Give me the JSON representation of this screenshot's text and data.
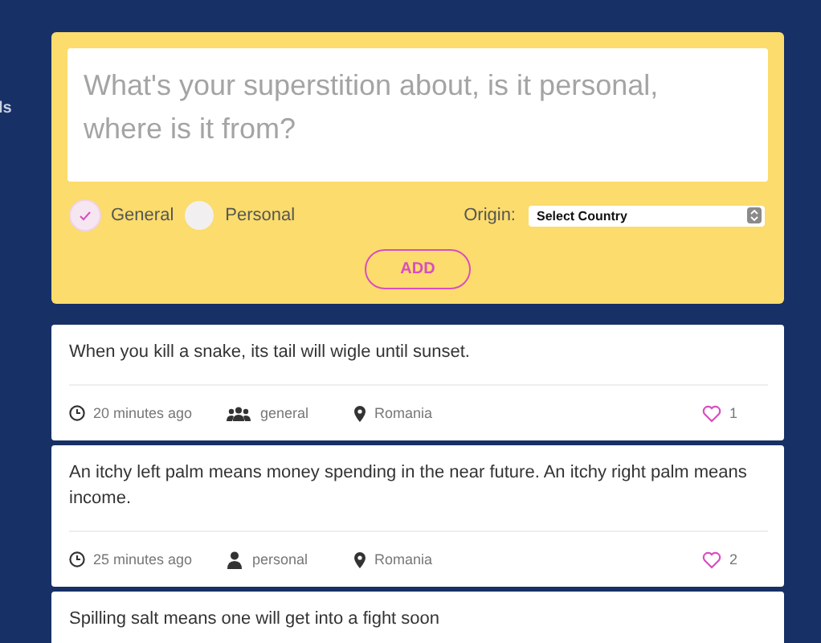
{
  "sidebar": {
    "text": "ls"
  },
  "form": {
    "placeholder": "What's your superstition about, is it personal, where is it from?",
    "options": [
      {
        "label": "General",
        "selected": true
      },
      {
        "label": "Personal",
        "selected": false
      }
    ],
    "origin_label": "Origin:",
    "origin_value": "Select Country",
    "add_button": "ADD"
  },
  "posts": [
    {
      "text": "When you kill a snake, its tail will wigle until sunset.",
      "time": "20 minutes ago",
      "kind": "general",
      "category": "general",
      "country": "Romania",
      "likes": "1"
    },
    {
      "text": "An itchy left palm means money spending in the near future. An itchy right palm means income.",
      "time": "25 minutes ago",
      "kind": "personal",
      "category": "personal",
      "country": "Romania",
      "likes": "2"
    },
    {
      "text": "Spilling salt means one will get into a fight soon"
    }
  ]
}
